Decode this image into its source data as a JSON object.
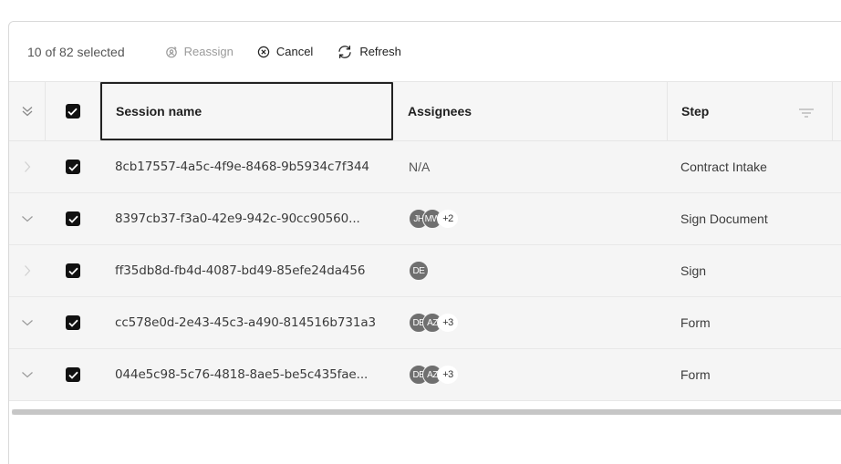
{
  "toolbar": {
    "selection": "10 of 82 selected",
    "reassign_label": "Reassign",
    "cancel_label": "Cancel",
    "refresh_label": "Refresh"
  },
  "columns": {
    "session_name": "Session name",
    "assignees": "Assignees",
    "step": "Step"
  },
  "rows": [
    {
      "session": "8cb17557-4a5c-4f9e-8468-9b5934c7f344",
      "assignees": [],
      "assignees_text": "N/A",
      "more": "",
      "step": "Contract Intake",
      "expandable": false
    },
    {
      "session": "8397cb37-f3a0-42e9-942c-90cc90560...",
      "assignees": [
        "JH",
        "MW"
      ],
      "assignees_text": "",
      "more": "+2",
      "step": "Sign Document",
      "expandable": true
    },
    {
      "session": "ff35db8d-fb4d-4087-bd49-85efe24da456",
      "assignees": [
        "DE"
      ],
      "assignees_text": "",
      "more": "",
      "step": "Sign",
      "expandable": false
    },
    {
      "session": "cc578e0d-2e43-45c3-a490-814516b731a3",
      "assignees": [
        "DE",
        "AZ"
      ],
      "assignees_text": "",
      "more": "+3",
      "step": "Form",
      "expandable": true
    },
    {
      "session": "044e5c98-5c76-4818-8ae5-be5c435fae...",
      "assignees": [
        "DE",
        "AZ"
      ],
      "assignees_text": "",
      "more": "+3",
      "step": "Form",
      "expandable": true
    }
  ]
}
